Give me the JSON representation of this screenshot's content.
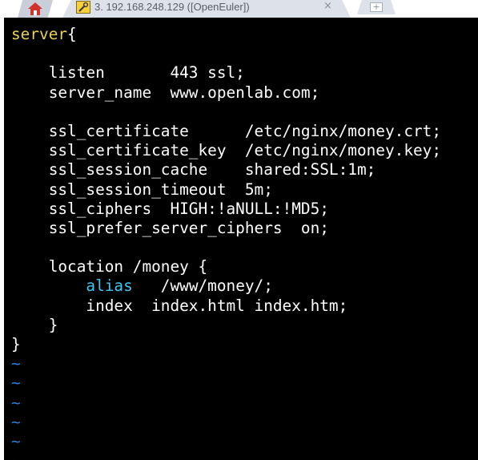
{
  "tabs": {
    "home_icon": "home-icon",
    "active": {
      "icon": "terminal-tool-icon",
      "title": "3. 192.168.248.129 ([OpenEuler])",
      "close_glyph": "×"
    },
    "new_tab_glyph": "+"
  },
  "editor": {
    "colors": {
      "background": "#000000",
      "text": "#ffffff",
      "keyword": "#e8d453",
      "directive": "#3fc5f0",
      "tilde": "#2b7fd9"
    },
    "lines": [
      {
        "parts": [
          {
            "text": "server",
            "style": "yellow"
          },
          {
            "text": "{",
            "style": "plain"
          }
        ]
      },
      {
        "parts": []
      },
      {
        "parts": [
          {
            "text": "    listen       443 ssl;",
            "style": "plain"
          }
        ]
      },
      {
        "parts": [
          {
            "text": "    server_name  www.openlab.com;",
            "style": "plain"
          }
        ]
      },
      {
        "parts": []
      },
      {
        "parts": [
          {
            "text": "    ssl_certificate      /etc/nginx/money.crt;",
            "style": "plain"
          }
        ]
      },
      {
        "parts": [
          {
            "text": "    ssl_certificate_key  /etc/nginx/money.key;",
            "style": "plain"
          }
        ]
      },
      {
        "parts": [
          {
            "text": "    ssl_session_cache    shared:SSL:1m;",
            "style": "plain"
          }
        ]
      },
      {
        "parts": [
          {
            "text": "    ssl_session_timeout  5m;",
            "style": "plain"
          }
        ]
      },
      {
        "parts": [
          {
            "text": "    ssl_ciphers  HIGH:!aNULL:!MD5;",
            "style": "plain"
          }
        ]
      },
      {
        "parts": [
          {
            "text": "    ssl_prefer_server_ciphers  on;",
            "style": "plain"
          }
        ]
      },
      {
        "parts": []
      },
      {
        "parts": [
          {
            "text": "    location /money {",
            "style": "plain"
          }
        ]
      },
      {
        "parts": [
          {
            "text": "        ",
            "style": "plain"
          },
          {
            "text": "alias",
            "style": "cyan"
          },
          {
            "text": "   /www/money/;",
            "style": "plain"
          }
        ]
      },
      {
        "parts": [
          {
            "text": "        index  index.html index.htm;",
            "style": "plain"
          }
        ]
      },
      {
        "parts": [
          {
            "text": "    }",
            "style": "plain"
          }
        ]
      },
      {
        "parts": [
          {
            "text": "}",
            "style": "plain"
          }
        ]
      },
      {
        "parts": [
          {
            "text": "~",
            "style": "tilde"
          }
        ]
      },
      {
        "parts": [
          {
            "text": "~",
            "style": "tilde"
          }
        ]
      },
      {
        "parts": [
          {
            "text": "~",
            "style": "tilde"
          }
        ]
      },
      {
        "parts": [
          {
            "text": "~",
            "style": "tilde"
          }
        ]
      },
      {
        "parts": [
          {
            "text": "~",
            "style": "tilde"
          }
        ]
      },
      {
        "parts": [
          {
            "text": "~",
            "style": "tilde"
          }
        ]
      }
    ]
  }
}
